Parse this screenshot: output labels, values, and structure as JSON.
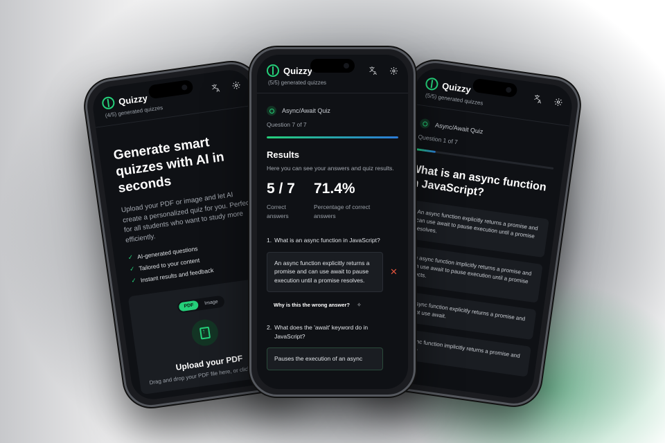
{
  "app": {
    "name": "Quizzy"
  },
  "left": {
    "quota": "(4/5) generated quizzes",
    "hero_title": "Generate smart quizzes with AI in seconds",
    "hero_desc": "Upload your PDF or image and let AI create a personalized quiz for you. Perfect for all students who want to study more efficiently.",
    "features": [
      "AI-generated questions",
      "Tailored to your content",
      "Instant results and feedback"
    ],
    "toggle": {
      "pdf": "PDF",
      "image": "Image",
      "selected": "PDF"
    },
    "upload_title": "Upload your PDF",
    "upload_sub": "Drag and drop your PDF file here, or click to select"
  },
  "center": {
    "quota": "(5/5) generated quizzes",
    "quiz_name": "Async/Await Quiz",
    "question_progress": "Question 7 of 7",
    "progress": 1.0,
    "results_title": "Results",
    "results_sub": "Here you can see your answers and quiz results.",
    "score": "5 / 7",
    "score_label": "Correct answers",
    "percent": "71.4%",
    "percent_label": "Percentage of correct answers",
    "q1_number": "1.",
    "q1_text": "What is an async function in JavaScript?",
    "q1_answer": "An async function explicitly returns a promise and can use await to pause execution until a promise resolves.",
    "q1_wrong_mark": "✕",
    "why_label": "Why is this the wrong answer?",
    "q2_number": "2.",
    "q2_text": "What does the 'await' keyword do in JavaScript?",
    "q2_answer": "Pauses the execution of an async"
  },
  "right": {
    "quota": "(5/5) generated quizzes",
    "quiz_name": "Async/Await Quiz",
    "question_progress": "Question 1 of 7",
    "progress": 0.14,
    "question": "What is an async function in JavaScript?",
    "options": [
      {
        "letter": "A",
        "text": "An async function explicitly returns a promise and can use await to pause execution until a promise resolves."
      },
      {
        "letter": "",
        "text": "An async function implicitly returns a promise and can use await to pause execution until a promise rejects."
      },
      {
        "letter": "",
        "text": "An async function explicitly returns a promise and cannot use await."
      },
      {
        "letter": "",
        "text": "An async function implicitly returns a promise and can use"
      }
    ]
  },
  "icons": {
    "translate": "translate-icon",
    "settings": "gear-icon",
    "brain": "brain-logo-icon"
  },
  "colors": {
    "accent": "#25d07a",
    "background": "#0f1115",
    "error": "#e0533d",
    "progress_end": "#2b7bd8"
  }
}
